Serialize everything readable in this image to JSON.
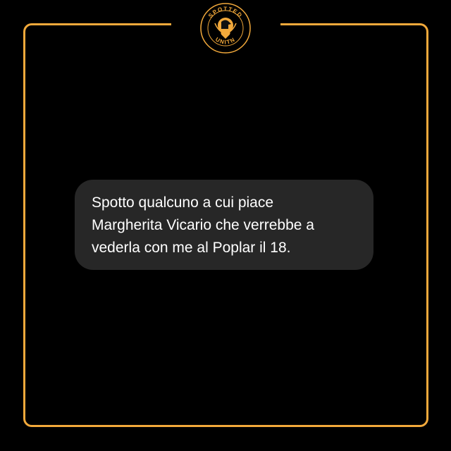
{
  "logo": {
    "top_text": "SPOTTED",
    "bottom_text": "UNITN"
  },
  "post": {
    "lines": [
      "Spotto qualcuno a cui piace",
      "Margherita Vicario che verrebbe a",
      "vederla con me al Poplar il 18."
    ]
  },
  "colors": {
    "accent": "#f2a93b",
    "bubble": "#272727",
    "background": "#000000"
  }
}
